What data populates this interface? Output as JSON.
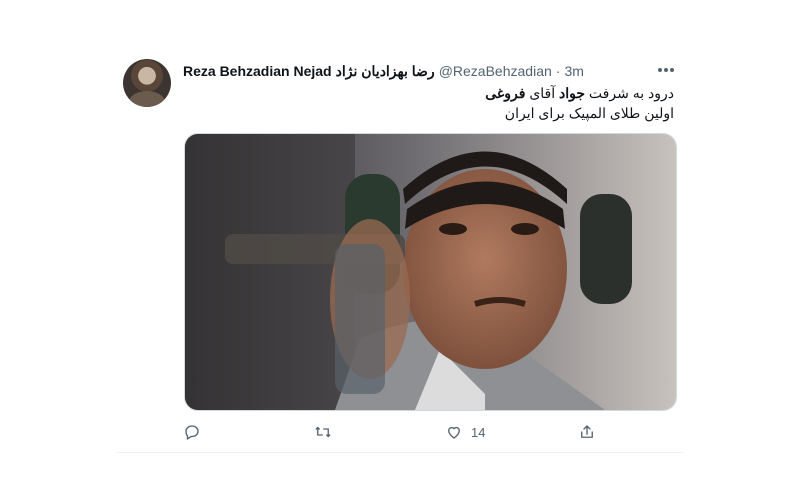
{
  "tweet": {
    "author_name": "Reza Behzadian Nejad",
    "author_name_fa": "رضا بهزادیان نژاد",
    "handle": "@RezaBehzadian",
    "separator": "·",
    "time": "3m",
    "line1_prefix": "درود به شرفت",
    "line1_bold1": "جواد",
    "line1_mid": "آقای",
    "line1_bold2": "فروغی",
    "line2": "اولین طلای المپیک برای ایران",
    "like_count": "14"
  },
  "icons": {
    "more": "more-horizontal-icon",
    "reply": "reply-icon",
    "retweet": "retweet-icon",
    "like": "heart-icon",
    "share": "share-icon"
  },
  "colors": {
    "text_primary": "#0f1419",
    "text_secondary": "#536471",
    "border": "#cfd9de"
  }
}
